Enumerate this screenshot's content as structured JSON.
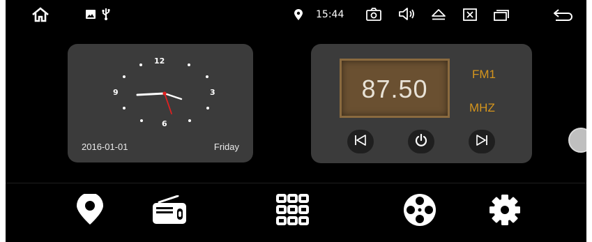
{
  "status_bar": {
    "time": "15:44",
    "icons": [
      "home-icon",
      "image-icon",
      "usb-icon",
      "location-icon",
      "screenshot-icon",
      "volume-icon",
      "eject-icon",
      "close-window-icon",
      "recent-apps-icon",
      "back-icon"
    ]
  },
  "clock_widget": {
    "numbers": {
      "twelve": "12",
      "three": "3",
      "six": "6",
      "nine": "9"
    },
    "date": "2016-01-01",
    "day": "Friday"
  },
  "radio_widget": {
    "frequency": "87.50",
    "band": "FM1",
    "unit": "MHZ",
    "buttons": [
      "previous-icon",
      "power-icon",
      "next-icon"
    ]
  },
  "dock": {
    "items": [
      "navigation-icon",
      "radio-icon",
      "apps-grid-icon",
      "media-reel-icon",
      "settings-icon"
    ]
  },
  "colors": {
    "accent": "#d5951d",
    "card": "#3b3b3b",
    "freq_panel": "#6a5031",
    "second_hand": "#e32020"
  }
}
